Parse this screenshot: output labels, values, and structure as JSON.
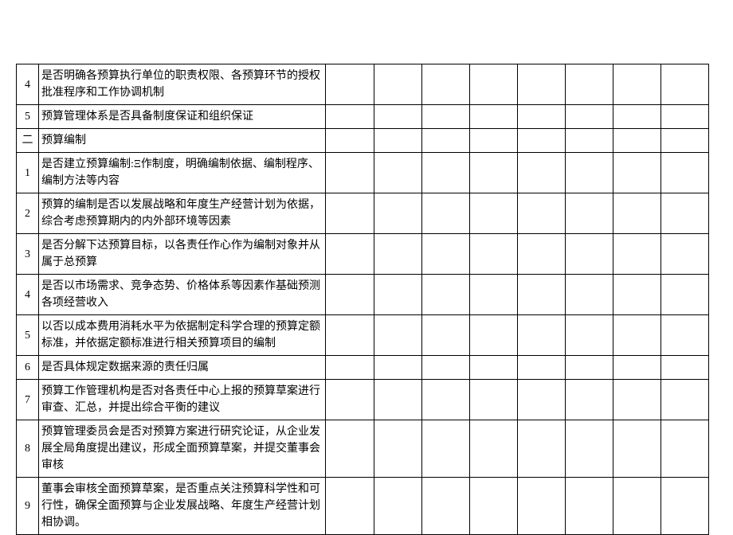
{
  "rows": [
    {
      "num": "4",
      "desc": "是否明确各预算执行单位的职责权限、各预算环节的授权批准程序和工作协调机制"
    },
    {
      "num": "5",
      "desc": "预算管理体系是否具备制度保证和组织保证"
    },
    {
      "num": "二",
      "desc": "预算编制"
    },
    {
      "num": "1",
      "desc": "是否建立预算编制:Ξ作制度，明确编制依据、编制程序、编制方法等内容"
    },
    {
      "num": "2",
      "desc": "预算的编制是否以发展战略和年度生产经营计划为依据，综合考虑预算期内的内外部环境等因素"
    },
    {
      "num": "3",
      "desc": "是否分解下达预算目标，以各责任作心作为编制对象并从属于总预算"
    },
    {
      "num": "4",
      "desc": "是否以市场需求、竞争态势、价格体系等因素作基础预测各项经营收入"
    },
    {
      "num": "5",
      "desc": "以否以成本费用消耗水平为依据制定科学合理的预算定额标准，并依据定额标准进行相关预算项目的编制"
    },
    {
      "num": "6",
      "desc": "是否具体规定数据来源的责任归属"
    },
    {
      "num": "7",
      "desc": "预算工作管理机构是否对各责任中心上报的预算草案进行审查、汇总，并提出综合平衡的建议"
    },
    {
      "num": "8",
      "desc": "预算管理委员会是否对预算方案进行研究论证，从企业发展全局角度提出建议，形成全面预算草案，并提交董事会审核"
    },
    {
      "num": "9",
      "desc": "董事会审核全面预算草案，是否重点关注预算科学性和可行性，确保全面预算与企业发展战略、年度生产经营计划相协调。"
    }
  ]
}
